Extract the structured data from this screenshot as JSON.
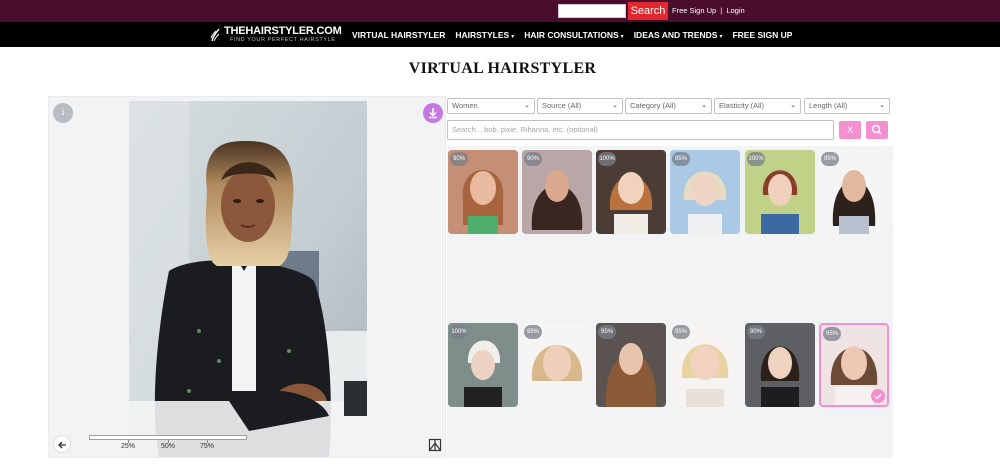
{
  "topbar": {
    "search_placeholder": "",
    "search_label": "Search",
    "links": [
      "Free Sign Up",
      "Login"
    ],
    "link_separator": "|"
  },
  "nav": {
    "logo_name": "THEHAIRSTYLER.COM",
    "logo_tagline": "FIND YOUR PERFECT HAIRSTYLE",
    "items": [
      {
        "label": "VIRTUAL HAIRSTYLER",
        "dropdown": false
      },
      {
        "label": "HAIRSTYLES",
        "dropdown": true
      },
      {
        "label": "HAIR CONSULTATIONS",
        "dropdown": true
      },
      {
        "label": "IDEAS AND TRENDS",
        "dropdown": true
      },
      {
        "label": "FREE SIGN UP",
        "dropdown": false
      }
    ],
    "caret": "▾"
  },
  "page_title": "VIRTUAL HAIRSTYLER",
  "editor": {
    "info_label": "i",
    "slider_marks": [
      "25%",
      "50%",
      "75%"
    ],
    "slider_value_percent": 100
  },
  "filters": [
    {
      "value": "Women"
    },
    {
      "value": "Source (All)"
    },
    {
      "value": "Category (All)"
    },
    {
      "value": "Elasticity (All)"
    },
    {
      "value": "Length (All)"
    }
  ],
  "search": {
    "placeholder": "Search... bob, pixie, Rihanna, etc. (optional)",
    "clear_label": "X"
  },
  "gallery": [
    {
      "match": "90%",
      "selected": false
    },
    {
      "match": "90%",
      "selected": false
    },
    {
      "match": "100%",
      "selected": false
    },
    {
      "match": "95%",
      "selected": false
    },
    {
      "match": "100%",
      "selected": false
    },
    {
      "match": "95%",
      "selected": false
    },
    {
      "match": "100%",
      "selected": false
    },
    {
      "match": "95%",
      "selected": false
    },
    {
      "match": "95%",
      "selected": false
    },
    {
      "match": "95%",
      "selected": false
    },
    {
      "match": "90%",
      "selected": false
    },
    {
      "match": "95%",
      "selected": true
    }
  ],
  "colors": {
    "topbar_bg": "#4a0d2b",
    "search_button": "#e2282e",
    "accent_pink": "#f48fd0",
    "download_purple": "#c47ae0"
  },
  "icons": {
    "logo": "hair-stroke-icon",
    "download": "download-icon",
    "back": "arrow-left-icon",
    "compare": "compare-icon",
    "search": "search-icon",
    "check": "check-icon"
  }
}
